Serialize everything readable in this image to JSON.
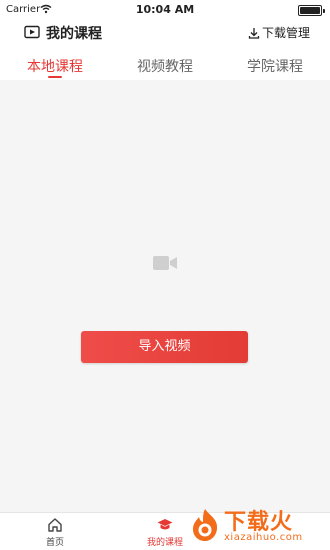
{
  "status_bar": {
    "carrier": "Carrier",
    "time": "10:04 AM"
  },
  "header": {
    "title": "我的课程",
    "download_label": "下载管理",
    "title_icon": "video-folder-icon",
    "download_icon": "download-icon"
  },
  "tabs": [
    {
      "label": "本地课程",
      "active": true
    },
    {
      "label": "视频教程",
      "active": false
    },
    {
      "label": "学院课程",
      "active": false
    }
  ],
  "main": {
    "empty_icon": "video-camera-icon",
    "import_button": "导入视频"
  },
  "bottom_nav": [
    {
      "label": "首页",
      "icon": "home-icon",
      "active": false
    },
    {
      "label": "我的课程",
      "icon": "graduation-cap-icon",
      "active": true
    }
  ],
  "watermark": {
    "text": "下载火",
    "sub": "xiazaihuo.com"
  },
  "colors": {
    "accent": "#e53935",
    "background": "#f5f5f5",
    "watermark": "#f26c1a"
  }
}
